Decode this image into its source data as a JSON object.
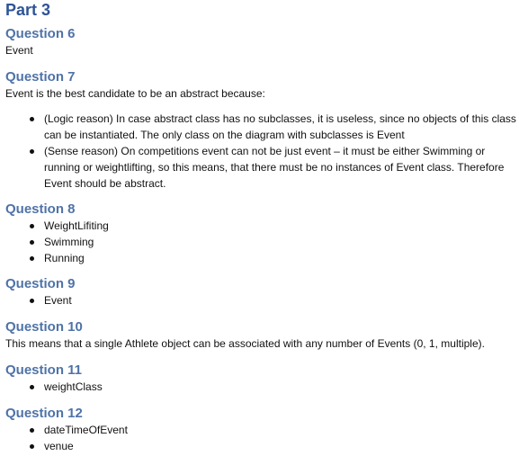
{
  "part_title": "Part 3",
  "sections": {
    "q6": {
      "heading": "Question 6",
      "text": "Event"
    },
    "q7": {
      "heading": "Question 7",
      "intro": "Event is the best candidate to be an abstract because:",
      "bullets": [
        "(Logic reason) In case abstract class has no subclasses, it is useless, since no objects of this class can be instantiated. The only class on the diagram with subclasses is Event",
        "(Sense reason) On competitions event can not be just event – it must be either Swimming or running or weightlifting, so this means, that there must be no instances of Event class. Therefore Event should be abstract."
      ]
    },
    "q8": {
      "heading": "Question 8",
      "bullets": [
        "WeightLifiting",
        "Swimming",
        "Running"
      ]
    },
    "q9": {
      "heading": "Question 9",
      "bullets": [
        "Event"
      ]
    },
    "q10": {
      "heading": "Question 10",
      "text": "This means that a single Athlete object can be associated with any number of Events (0, 1, multiple)."
    },
    "q11": {
      "heading": "Question 11",
      "bullets": [
        "weightClass"
      ]
    },
    "q12": {
      "heading": "Question 12",
      "bullets": [
        "dateTimeOfEvent",
        "venue"
      ]
    }
  },
  "colors": {
    "title": "#2f5496",
    "heading": "#4f73a8",
    "text": "#111111"
  }
}
